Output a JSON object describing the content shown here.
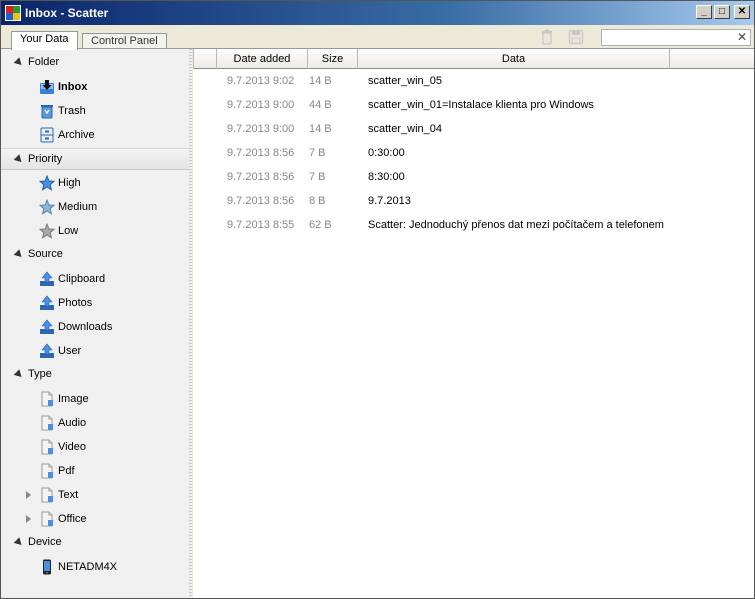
{
  "window": {
    "title": "Inbox - Scatter"
  },
  "window_controls": {
    "minimize": "_",
    "maximize": "□",
    "close": "✕"
  },
  "tabs": [
    {
      "label": "Your Data"
    },
    {
      "label": "Control Panel"
    }
  ],
  "toolbar": {
    "trash_icon": "trash-icon",
    "save_icon": "save-icon"
  },
  "search": {
    "value": "",
    "clear": "✕"
  },
  "sidebar": {
    "groups": [
      {
        "label": "Folder",
        "items": [
          {
            "label": "Inbox",
            "icon": "inbox-icon"
          },
          {
            "label": "Trash",
            "icon": "trash-icon"
          },
          {
            "label": "Archive",
            "icon": "archive-icon"
          }
        ]
      },
      {
        "label": "Priority",
        "items": [
          {
            "label": "High",
            "icon": "star-high-icon"
          },
          {
            "label": "Medium",
            "icon": "star-medium-icon"
          },
          {
            "label": "Low",
            "icon": "star-low-icon"
          }
        ]
      },
      {
        "label": "Source",
        "items": [
          {
            "label": "Clipboard",
            "icon": "upload-icon"
          },
          {
            "label": "Photos",
            "icon": "upload-icon"
          },
          {
            "label": "Downloads",
            "icon": "upload-icon"
          },
          {
            "label": "User",
            "icon": "upload-icon"
          }
        ]
      },
      {
        "label": "Type",
        "items": [
          {
            "label": "Image",
            "icon": "file-icon"
          },
          {
            "label": "Audio",
            "icon": "file-icon"
          },
          {
            "label": "Video",
            "icon": "file-icon"
          },
          {
            "label": "Pdf",
            "icon": "file-icon"
          },
          {
            "label": "Text",
            "icon": "file-icon"
          },
          {
            "label": "Office",
            "icon": "file-icon"
          }
        ]
      },
      {
        "label": "Device",
        "items": [
          {
            "label": "NETADM4X",
            "icon": "phone-icon"
          }
        ]
      }
    ]
  },
  "table": {
    "columns": [
      "Date added",
      "Size",
      "Data"
    ],
    "rows": [
      {
        "date": "9.7.2013 9:02",
        "size": "14 B",
        "data": "scatter_win_05"
      },
      {
        "date": "9.7.2013 9:00",
        "size": "44 B",
        "data": "scatter_win_01=Instalace klienta pro Windows"
      },
      {
        "date": "9.7.2013 9:00",
        "size": "14 B",
        "data": "scatter_win_04"
      },
      {
        "date": "9.7.2013 8:56",
        "size": "7 B",
        "data": "0:30:00"
      },
      {
        "date": "9.7.2013 8:56",
        "size": "7 B",
        "data": "8:30:00"
      },
      {
        "date": "9.7.2013 8:56",
        "size": "8 B",
        "data": "9.7.2013"
      },
      {
        "date": "9.7.2013 8:55",
        "size": "62 B",
        "data": "Scatter: Jednoduchý přenos dat mezi počítačem a telefonem"
      }
    ]
  },
  "colors": {
    "accent": "#0a246a",
    "muted_text": "#888888"
  }
}
